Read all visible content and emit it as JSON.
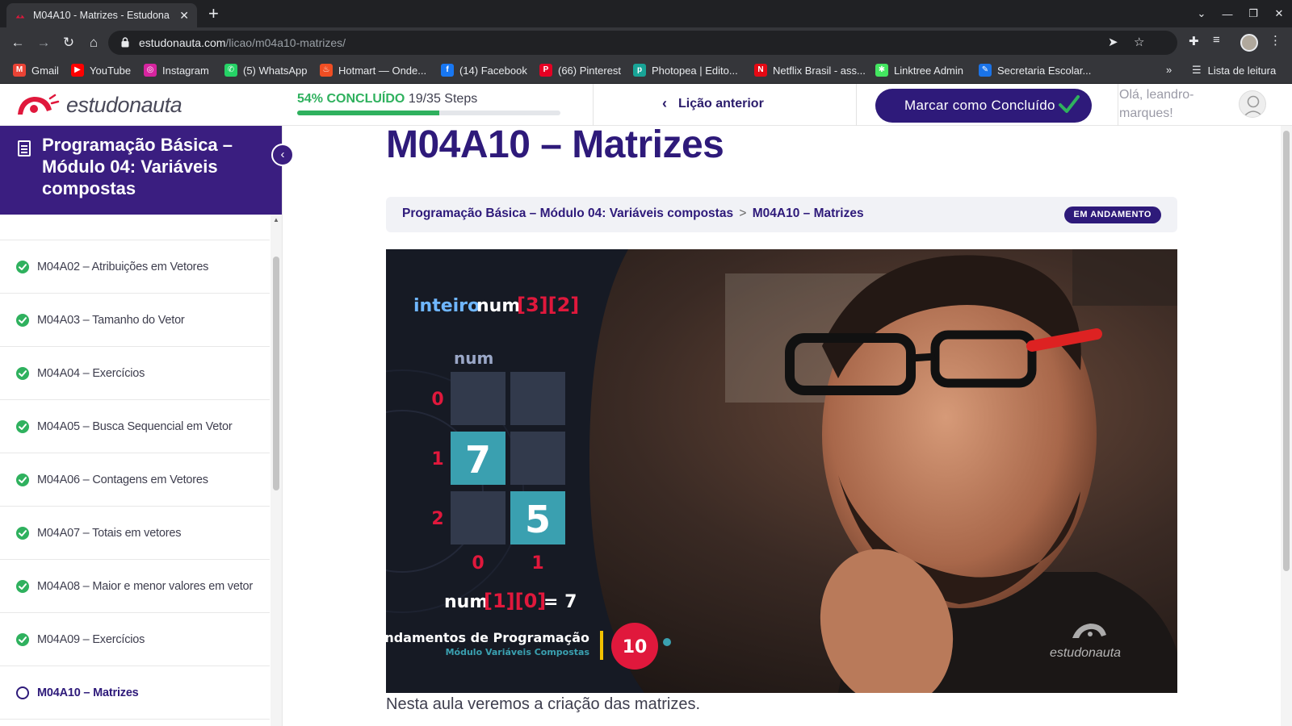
{
  "browser": {
    "tab_title": "M04A10 - Matrizes - Estudona",
    "url_host": "estudonauta.com",
    "url_path": "/licao/m04a10-matrizes/",
    "reading_list": "Lista de leitura",
    "bookmarks": [
      {
        "label": "Gmail",
        "icon": "gmail-icon",
        "color": "#ea4335"
      },
      {
        "label": "YouTube",
        "icon": "youtube-icon",
        "color": "#ff0000"
      },
      {
        "label": "Instagram",
        "icon": "instagram-icon",
        "color": "#d6249f"
      },
      {
        "label": "(5) WhatsApp",
        "icon": "whatsapp-icon",
        "color": "#25d366"
      },
      {
        "label": "Hotmart — Onde...",
        "icon": "hotmart-icon",
        "color": "#f04e23"
      },
      {
        "label": "(14) Facebook",
        "icon": "facebook-icon",
        "color": "#1877f2"
      },
      {
        "label": "(66) Pinterest",
        "icon": "pinterest-icon",
        "color": "#e60023"
      },
      {
        "label": "Photopea | Edito...",
        "icon": "photopea-icon",
        "color": "#18a497"
      },
      {
        "label": "Netflix Brasil - ass...",
        "icon": "netflix-icon",
        "color": "#e50914"
      },
      {
        "label": "Linktree Admin",
        "icon": "linktree-icon",
        "color": "#43e660"
      },
      {
        "label": "Secretaria Escolar...",
        "icon": "secretaria-icon",
        "color": "#1a73e8"
      }
    ]
  },
  "header": {
    "logo_text": "estudonauta",
    "progress_pct_label": "54% CONCLUÍDO",
    "progress_steps": "19/35 Steps",
    "progress_fraction": 0.54,
    "prev_lesson_label": "Lição anterior",
    "mark_complete_label": "Marcar como Concluído",
    "greeting": "Olá, leandro-marques!"
  },
  "sidebar": {
    "course_title": "Programação Básica – Módulo 04: Variáveis compostas",
    "lessons": [
      {
        "label": "M04A02 – Atribuições em Vetores",
        "status": "complete"
      },
      {
        "label": "M04A03 – Tamanho do Vetor",
        "status": "complete"
      },
      {
        "label": "M04A04 – Exercícios",
        "status": "complete"
      },
      {
        "label": "M04A05 – Busca Sequencial em Vetor",
        "status": "complete"
      },
      {
        "label": "M04A06 – Contagens em Vetores",
        "status": "complete"
      },
      {
        "label": "M04A07 – Totais em vetores",
        "status": "complete"
      },
      {
        "label": "M04A08 – Maior e menor valores em vetor",
        "status": "complete"
      },
      {
        "label": "M04A09 – Exercícios",
        "status": "complete"
      },
      {
        "label": "M04A10 – Matrizes",
        "status": "current"
      }
    ]
  },
  "main": {
    "title": "M04A10 – Matrizes",
    "breadcrumb_course": "Programação Básica – Módulo 04: Variáveis compostas",
    "breadcrumb_sep": ">",
    "breadcrumb_lesson": "M04A10 – Matrizes",
    "status_badge": "EM ANDAMENTO",
    "description": "Nesta aula veremos a criação das matrizes."
  },
  "video": {
    "decl_type": "inteiro",
    "decl_name": "num",
    "decl_dims": "[3][2]",
    "matrix_label": "num",
    "row_labels": [
      "0",
      "1",
      "2"
    ],
    "col_labels": [
      "0",
      "1"
    ],
    "cell_1_0": "7",
    "cell_2_1": "5",
    "expr_name": "num",
    "expr_index": "[1][0]",
    "expr_value": "= 7",
    "series_title": "Fundamentos de Programação",
    "series_subtitle": "Módulo Variáveis Compostas",
    "episode_number": "10",
    "watermark": "estudonauta",
    "colors": {
      "accent_red": "#e0183c",
      "cell_teal": "#3aa0b0",
      "cell_dark": "#323a4c",
      "code_blue": "#6fb6ff"
    }
  }
}
